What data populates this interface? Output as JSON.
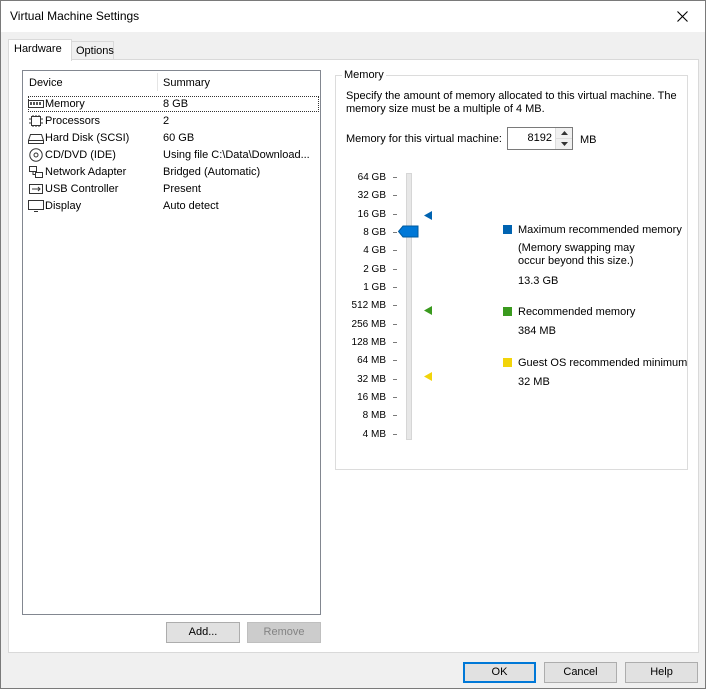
{
  "window": {
    "title": "Virtual Machine Settings"
  },
  "tabs": [
    {
      "label": "Hardware"
    },
    {
      "label": "Options"
    }
  ],
  "device_list": {
    "headers": {
      "device": "Device",
      "summary": "Summary"
    },
    "rows": [
      {
        "icon": "memory-icon",
        "device": "Memory",
        "summary": "8 GB",
        "selected": true
      },
      {
        "icon": "processor-icon",
        "device": "Processors",
        "summary": "2"
      },
      {
        "icon": "hard-disk-icon",
        "device": "Hard Disk (SCSI)",
        "summary": "60 GB"
      },
      {
        "icon": "cd-dvd-icon",
        "device": "CD/DVD (IDE)",
        "summary": "Using file C:\\Data\\Download..."
      },
      {
        "icon": "network-adapter-icon",
        "device": "Network Adapter",
        "summary": "Bridged (Automatic)"
      },
      {
        "icon": "usb-icon",
        "device": "USB Controller",
        "summary": "Present"
      },
      {
        "icon": "display-icon",
        "device": "Display",
        "summary": "Auto detect"
      }
    ]
  },
  "device_buttons": {
    "add": "Add...",
    "remove": "Remove"
  },
  "memory": {
    "group_label": "Memory",
    "description": "Specify the amount of memory allocated to this virtual machine. The memory size must be a multiple of 4 MB.",
    "field_label": "Memory for this virtual machine:",
    "value": "8192",
    "unit": "MB",
    "scale": [
      "64 GB",
      "32 GB",
      "16 GB",
      "8 GB",
      "4 GB",
      "2 GB",
      "1 GB",
      "512 MB",
      "256 MB",
      "128 MB",
      "64 MB",
      "32 MB",
      "16 MB",
      "8 MB",
      "4 MB"
    ],
    "slider_level": "8 GB",
    "legend": {
      "max": {
        "title": "Maximum recommended memory",
        "note_line1": "(Memory swapping may",
        "note_line2": "occur beyond this size.)",
        "value": "13.3 GB",
        "color": "#0063b1"
      },
      "recommended": {
        "title": "Recommended memory",
        "value": "384 MB",
        "color": "#3a9a1e"
      },
      "guest_min": {
        "title": "Guest OS recommended minimum",
        "value": "32 MB",
        "color": "#f2d40a"
      }
    }
  },
  "footer": {
    "ok": "OK",
    "cancel": "Cancel",
    "help": "Help"
  }
}
